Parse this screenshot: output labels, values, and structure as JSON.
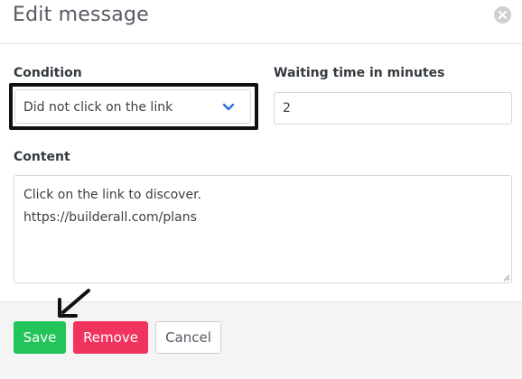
{
  "modal": {
    "title": "Edit message"
  },
  "condition": {
    "label": "Condition",
    "selected": "Did not click on the link"
  },
  "waiting": {
    "label": "Waiting time in minutes",
    "value": "2"
  },
  "content": {
    "label": "Content",
    "lines": [
      "Click on the link to discover.",
      "https://builderall.com/plans"
    ]
  },
  "buttons": {
    "save": "Save",
    "remove": "Remove",
    "cancel": "Cancel"
  },
  "icons": {
    "close": "close-icon",
    "chevron": "chevron-down-icon",
    "arrow": "arrow-pointer-icon",
    "grip": "resize-grip-icon"
  },
  "colors": {
    "save": "#23c55a",
    "remove": "#f0345e",
    "highlight": "#111111",
    "chevron": "#2f6fd6"
  }
}
